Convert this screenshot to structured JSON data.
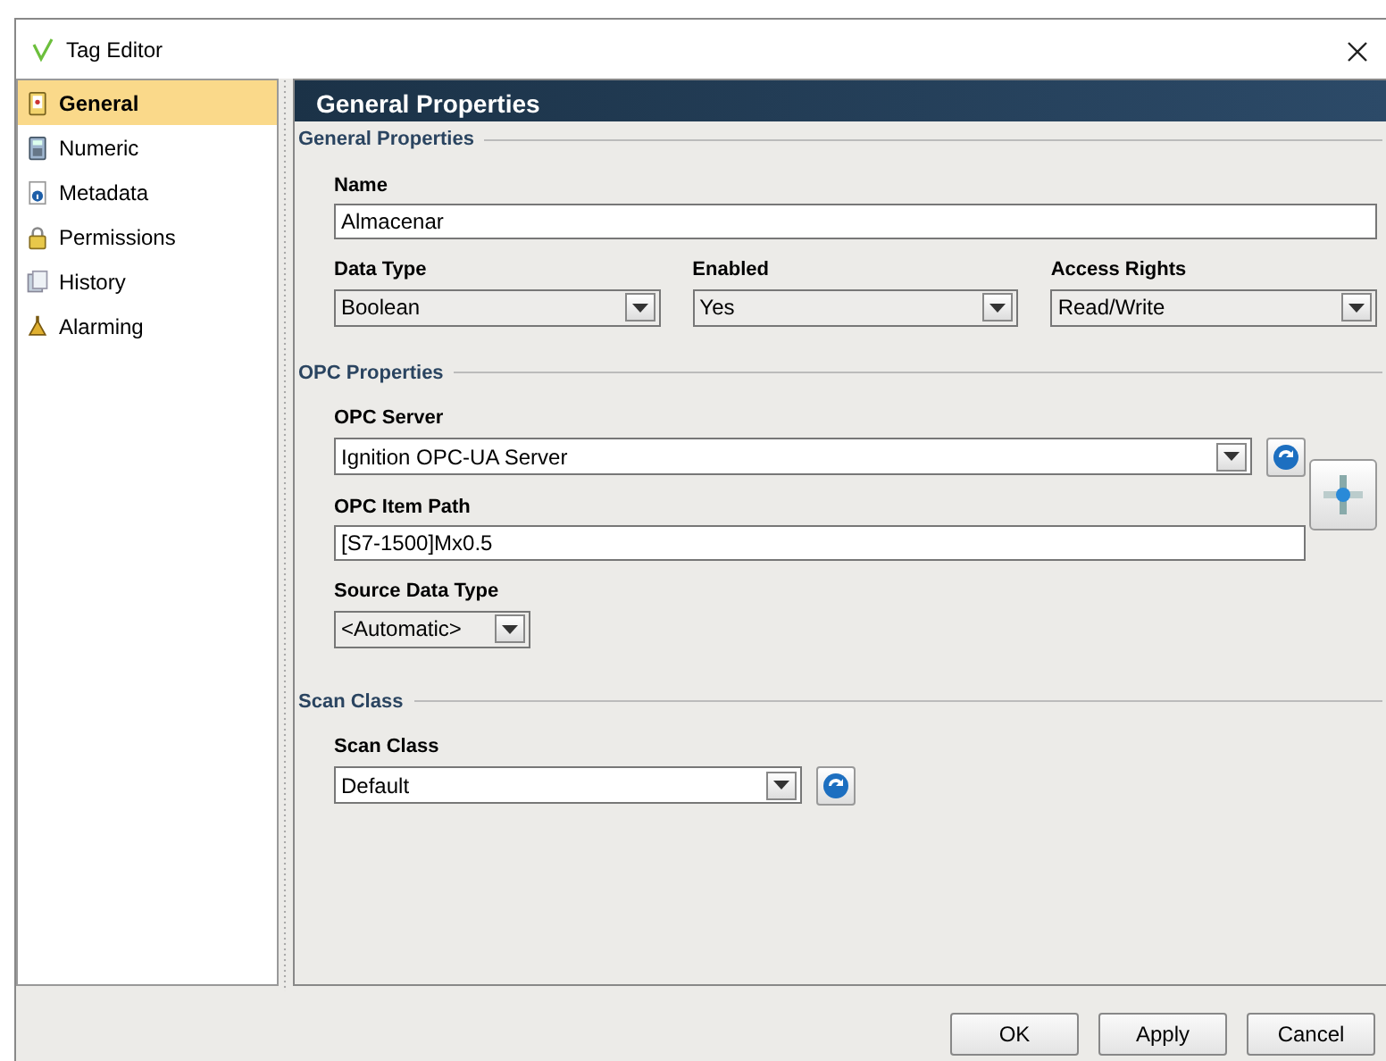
{
  "window": {
    "title": "Tag Editor"
  },
  "sidebar": {
    "items": [
      {
        "label": "General",
        "selected": true,
        "kind": "general"
      },
      {
        "label": "Numeric",
        "selected": false,
        "kind": "numeric"
      },
      {
        "label": "Metadata",
        "selected": false,
        "kind": "metadata"
      },
      {
        "label": "Permissions",
        "selected": false,
        "kind": "permissions"
      },
      {
        "label": "History",
        "selected": false,
        "kind": "history"
      },
      {
        "label": "Alarming",
        "selected": false,
        "kind": "alarming"
      }
    ]
  },
  "panel": {
    "title": "General Properties"
  },
  "sections": [
    {
      "title": "General Properties",
      "browse_button": false,
      "rows": [
        [
          {
            "label": "Name",
            "kind": "text",
            "value": "Almacenar",
            "refresh_button": false
          }
        ],
        [
          {
            "label": "Data Type",
            "kind": "dropdown",
            "value": "Boolean",
            "refresh_button": false
          },
          {
            "label": "Enabled",
            "kind": "dropdown",
            "value": "Yes",
            "refresh_button": false
          },
          {
            "label": "Access Rights",
            "kind": "dropdown",
            "value": "Read/Write",
            "refresh_button": false
          }
        ]
      ]
    },
    {
      "title": "OPC Properties",
      "browse_button": true,
      "rows": [
        [
          {
            "label": "OPC Server",
            "kind": "dropdown",
            "value": "Ignition OPC-UA Server",
            "refresh_button": true
          }
        ],
        [
          {
            "label": "OPC Item Path",
            "kind": "text",
            "value": "[S7-1500]Mx0.5",
            "refresh_button": false
          }
        ],
        [
          {
            "label": "Source Data Type",
            "kind": "compact-dropdown",
            "value": "<Automatic>",
            "refresh_button": false
          }
        ]
      ]
    },
    {
      "title": "Scan Class",
      "browse_button": false,
      "rows": [
        [
          {
            "label": "Scan Class",
            "kind": "dropdown",
            "value": "Default",
            "refresh_button": true
          }
        ]
      ]
    }
  ],
  "buttons": [
    "OK",
    "Apply",
    "Cancel"
  ]
}
